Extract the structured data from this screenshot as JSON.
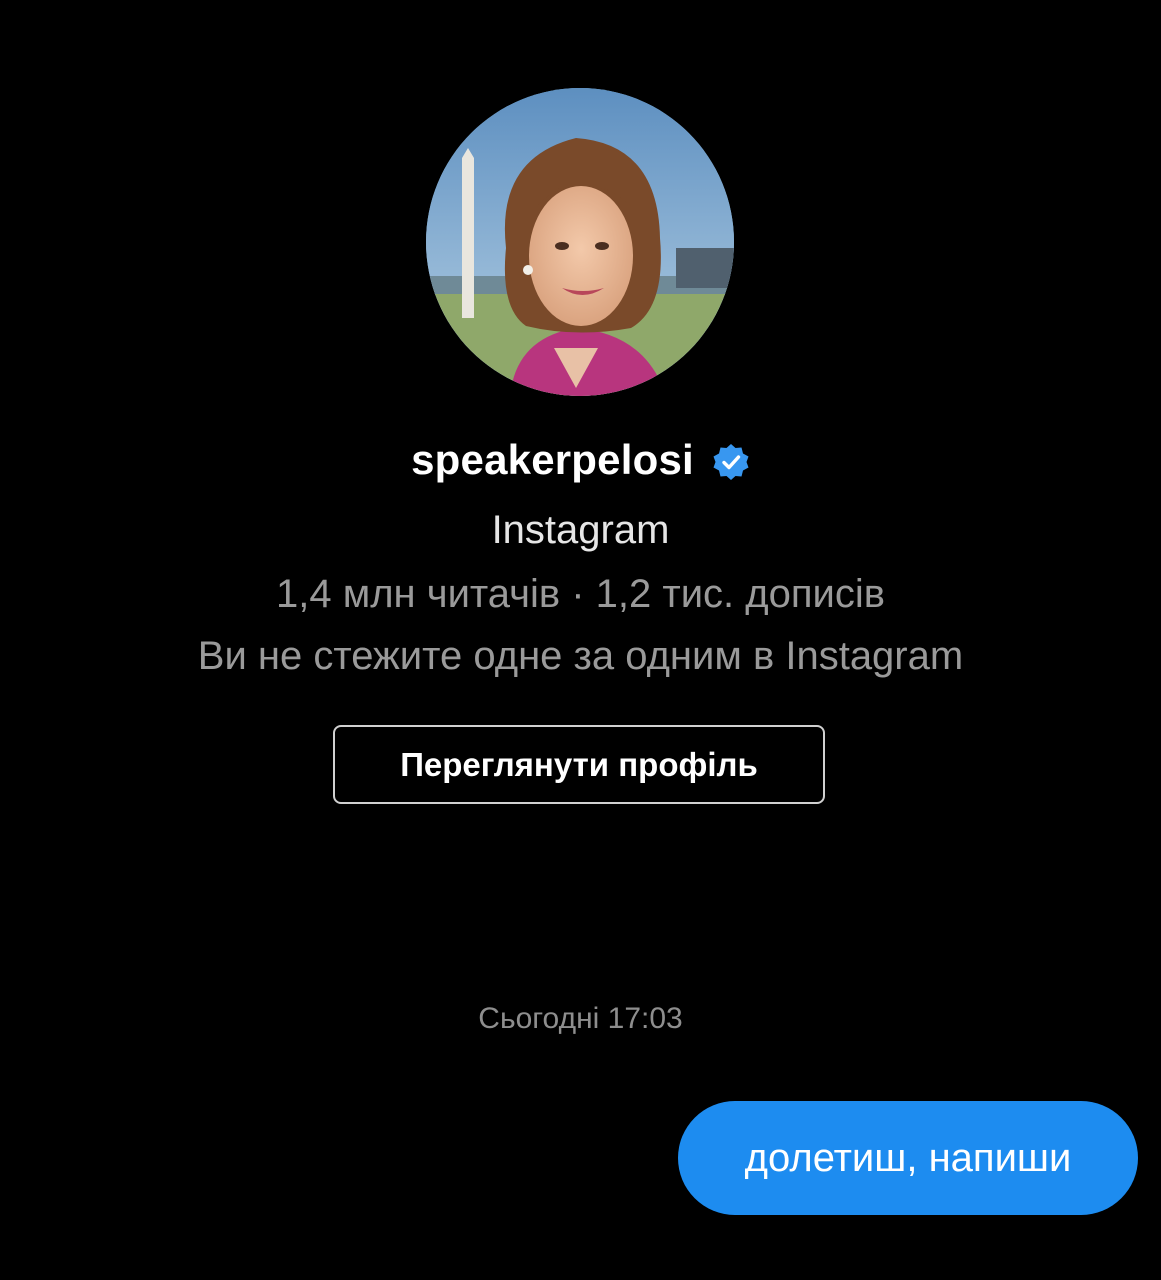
{
  "profile": {
    "username": "speakerpelosi",
    "platform": "Instagram",
    "stats": "1,4 млн читачів · 1,2 тис. дописів",
    "follow_status": "Ви не стежите одне за одним в Instagram",
    "view_profile_label": "Переглянути профіль",
    "verified_icon": "verified-badge-icon",
    "verified_color": "#3897f0"
  },
  "chat": {
    "timestamp": "Сьогодні 17:03",
    "messages": [
      {
        "text": "долетиш, напиши",
        "sender": "me"
      }
    ],
    "bubble_color": "#1d8cf0"
  }
}
